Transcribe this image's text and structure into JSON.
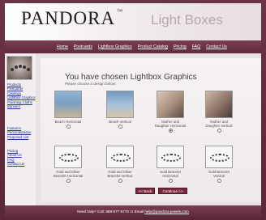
{
  "header": {
    "brand": "PANDORA",
    "brand_mark": "™",
    "section_title": "Light Boxes"
  },
  "nav": {
    "items": [
      {
        "label": "Home"
      },
      {
        "label": "Postcards"
      },
      {
        "label": "Lightbox Graphics"
      },
      {
        "label": "Product Catalog"
      },
      {
        "label": "Pricing"
      },
      {
        "label": "FAQ"
      },
      {
        "label": "Contact Us"
      }
    ]
  },
  "sidebar": {
    "group1": [
      {
        "label": "Products"
      },
      {
        "label": "Postcards"
      },
      {
        "label": "Catalogs"
      },
      {
        "label": "Lightbox Graphics"
      },
      {
        "label": "Polishing Cloths"
      },
      {
        "label": "Banners"
      }
    ],
    "group2": [
      {
        "label": "Features"
      },
      {
        "label": "Personalization"
      },
      {
        "label": "Proposed List"
      }
    ],
    "group3": [
      {
        "label": "Pricing"
      },
      {
        "label": "About Us"
      },
      {
        "label": "FAQ"
      },
      {
        "label": "Contact Us"
      }
    ]
  },
  "main": {
    "title": "You have chosen Lightbox Graphics",
    "subtitle": "Please choose a design below:",
    "options_row1": [
      {
        "label": "Beach Horizontal",
        "checked": false
      },
      {
        "label": "Beach Vertical",
        "checked": false
      },
      {
        "label": "Mother and Daughter Horizontal",
        "checked": true
      },
      {
        "label": "Mother and Daughter Vertical",
        "checked": false
      }
    ],
    "options_row2": [
      {
        "label": "Gold and Silver Bracelet Horizontal",
        "checked": false
      },
      {
        "label": "Gold and Silver Bracelet Vertical",
        "checked": false
      },
      {
        "label": "Gold Bracelet Horizontal",
        "checked": false
      },
      {
        "label": "Gold Bracelet Vertical",
        "checked": false
      }
    ],
    "back_label": "<< Back",
    "continue_label": "Continue >>"
  },
  "footer": {
    "text": "Need help? Call: 888-677-5770 or Email",
    "email": "help@pandora-jewels.com"
  }
}
